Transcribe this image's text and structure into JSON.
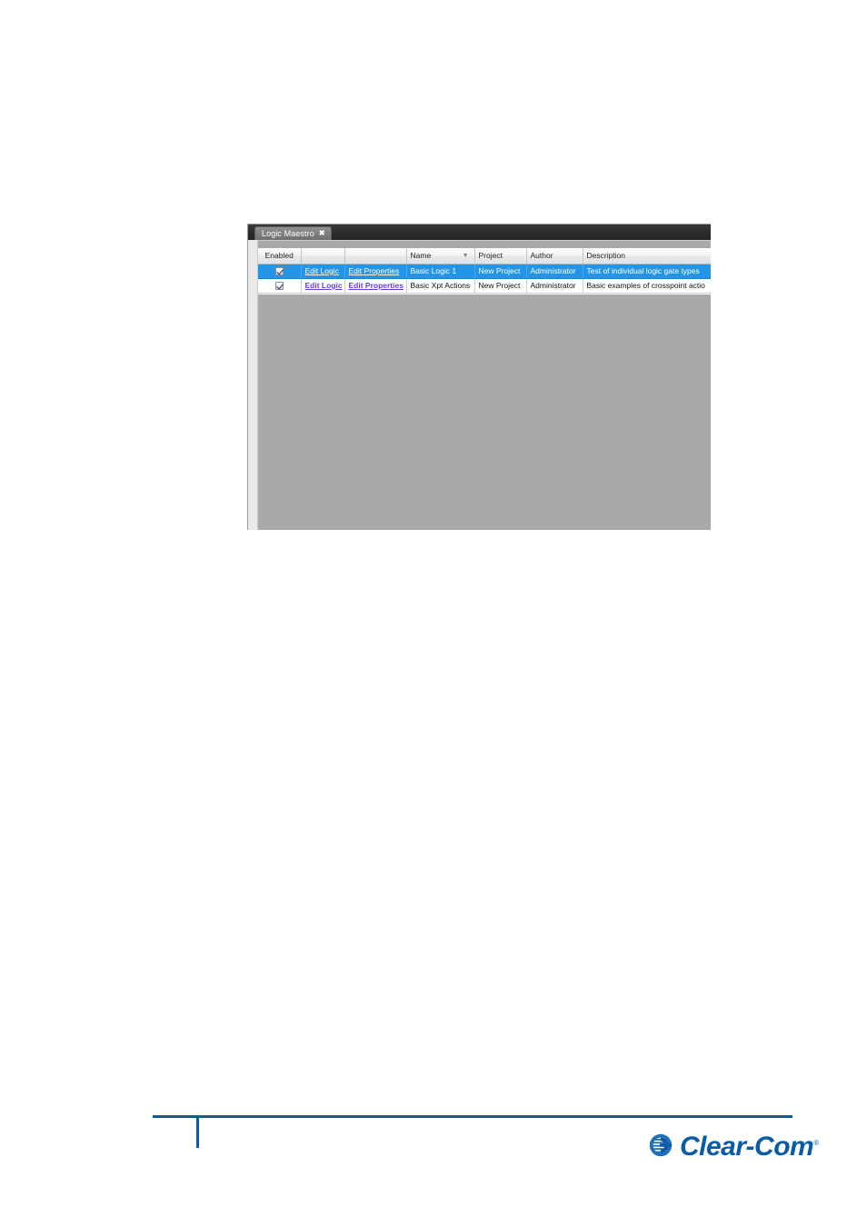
{
  "window": {
    "tab": {
      "label": "Logic Maestro",
      "close_icon": "close-icon",
      "close_glyph": "✖"
    }
  },
  "grid": {
    "columns": [
      {
        "key": "enabled",
        "label": "Enabled",
        "sorted": false
      },
      {
        "key": "edit_logic",
        "label": "",
        "sorted": false
      },
      {
        "key": "edit_properties",
        "label": "",
        "sorted": false
      },
      {
        "key": "name",
        "label": "Name",
        "sorted": true,
        "sort_glyph": "▼"
      },
      {
        "key": "project",
        "label": "Project",
        "sorted": false
      },
      {
        "key": "author",
        "label": "Author",
        "sorted": false
      },
      {
        "key": "description",
        "label": "Description",
        "sorted": false
      }
    ],
    "rows": [
      {
        "selected": true,
        "enabled": true,
        "edit_logic": "Edit Logic",
        "edit_properties": "Edit Properties",
        "name": "Basic Logic 1",
        "project": "New Project",
        "author": "Administrator",
        "description": "Test of individual logic gate types"
      },
      {
        "selected": false,
        "enabled": true,
        "edit_logic": "Edit Logic",
        "edit_properties": "Edit Properties",
        "name": "Basic Xpt Actions",
        "project": "New Project",
        "author": "Administrator",
        "description": "Basic examples of crosspoint actio"
      }
    ]
  },
  "footer": {
    "brand": "Clear-Com",
    "brand_tm": "®",
    "brand_color": "#0a5ba3",
    "logo_icon": "clear-com-swirl-icon"
  }
}
